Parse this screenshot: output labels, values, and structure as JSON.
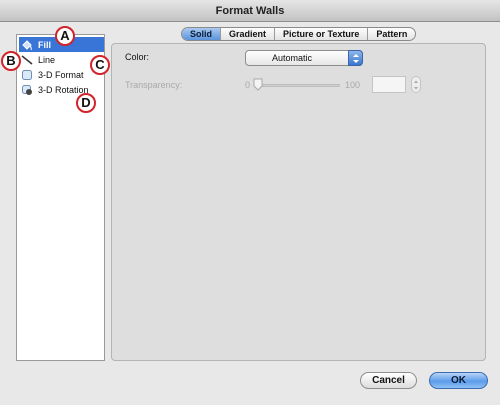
{
  "window": {
    "title": "Format Walls"
  },
  "sidebar": {
    "items": [
      {
        "label": "Fill",
        "icon": "paint-bucket-icon",
        "selected": true
      },
      {
        "label": "Line",
        "icon": "line-icon",
        "selected": false
      },
      {
        "label": "3-D Format",
        "icon": "3d-format-icon",
        "selected": false
      },
      {
        "label": "3-D Rotation",
        "icon": "3d-rotation-icon",
        "selected": false
      }
    ]
  },
  "tabs": [
    {
      "label": "Solid",
      "active": true
    },
    {
      "label": "Gradient",
      "active": false
    },
    {
      "label": "Picture or Texture",
      "active": false
    },
    {
      "label": "Pattern",
      "active": false
    }
  ],
  "solid": {
    "color_label": "Color:",
    "color_value": "Automatic",
    "transparency_label": "Transparency:",
    "transparency_min": "0",
    "transparency_max": "100",
    "transparency_field": ""
  },
  "buttons": {
    "cancel": "Cancel",
    "ok": "OK"
  },
  "callouts": {
    "a": "A",
    "b": "B",
    "c": "C",
    "d": "D"
  },
  "colors": {
    "selection": "#3875d7",
    "callout_ring": "#d2232a",
    "ok_button": "#5c9cea"
  }
}
